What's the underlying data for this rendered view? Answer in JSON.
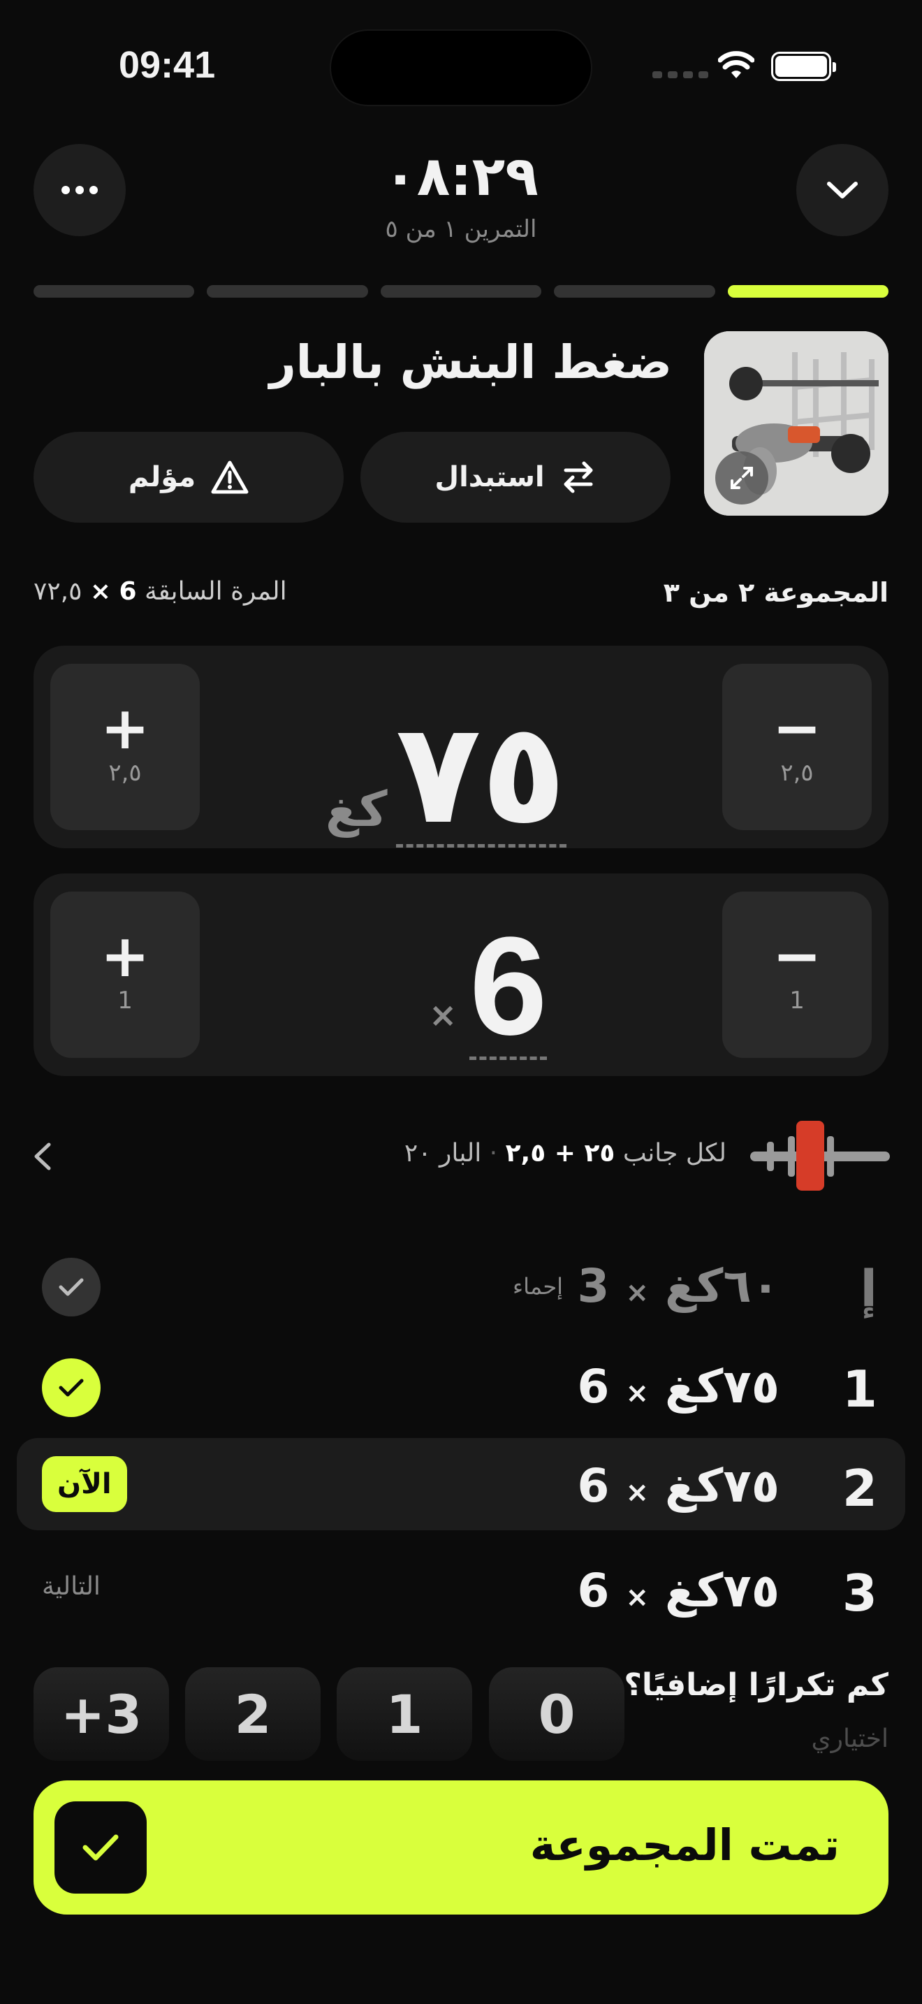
{
  "status_bar": {
    "time": "09:41"
  },
  "header": {
    "timer": "٠٨:٢٩",
    "exercise_progress": "التمرين ١ من ٥",
    "segments_total": 5,
    "segments_active": 1
  },
  "exercise": {
    "name": "ضغط البنش بالبار",
    "swap_label": "استبدال",
    "pain_label": "مؤلم",
    "thumbnail_icon": "bench-press-illustration",
    "expand_icon": "expand-icon"
  },
  "set_info": {
    "current": "المجموعة ٢ من ٣",
    "previous_label": "المرة السابقة",
    "previous_reps": "6",
    "previous_x": "×",
    "previous_weight": "٧٢,٥"
  },
  "weight_stepper": {
    "value": "٧٥",
    "unit": "كغ",
    "step_plus": "٢,٥",
    "step_minus": "٢,٥",
    "plus_symbol": "+",
    "minus_symbol": "−"
  },
  "reps_stepper": {
    "value": "6",
    "prefix": "×",
    "step_plus": "1",
    "step_minus": "1",
    "plus_symbol": "+",
    "minus_symbol": "−"
  },
  "plates": {
    "per_side_label": "لكل جانب",
    "per_side_value": "٢٥ + ٢,٥",
    "bar_label": "البار ٢٠",
    "colors": {
      "plate": "#d63c28",
      "bar": "#9a9a9a"
    }
  },
  "sets": [
    {
      "index": "إ",
      "weight": "٦٠كغ",
      "x": "×",
      "reps": "3",
      "tag": "إحماء",
      "state": "warmup"
    },
    {
      "index": "1",
      "weight": "٧٥كغ",
      "x": "×",
      "reps": "6",
      "tag": "",
      "state": "done"
    },
    {
      "index": "2",
      "weight": "٧٥كغ",
      "x": "×",
      "reps": "6",
      "tag": "الآن",
      "state": "current"
    },
    {
      "index": "3",
      "weight": "٧٥كغ",
      "x": "×",
      "reps": "6",
      "tag": "التالية",
      "state": "next"
    }
  ],
  "rir": {
    "question": "كم تكرارًا إضافيًا؟",
    "optional": "اختياري",
    "options": [
      "0",
      "1",
      "2",
      "3+"
    ]
  },
  "complete_button": {
    "label": "تمت المجموعة"
  },
  "colors": {
    "accent": "#d9ff3c",
    "background": "#0b0b0b",
    "card": "#1a1a1a"
  }
}
